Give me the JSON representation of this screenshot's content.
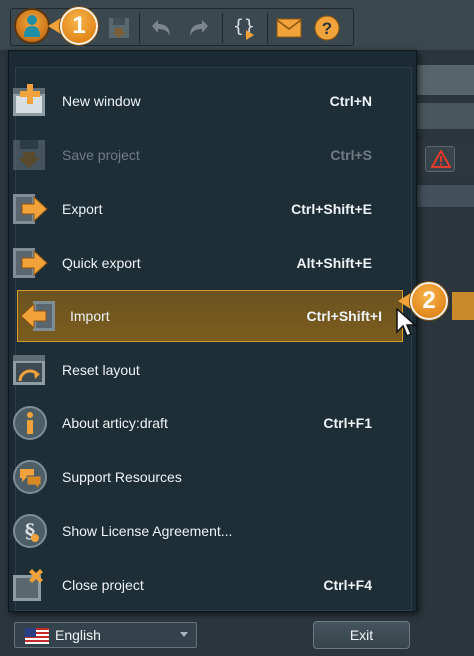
{
  "toolbar": {
    "buttons": [
      {
        "name": "user-icon"
      },
      {
        "name": "save-icon"
      },
      {
        "name": "undo-icon"
      },
      {
        "name": "redo-icon"
      },
      {
        "name": "script-icon"
      },
      {
        "name": "mail-icon"
      },
      {
        "name": "help-icon",
        "glyph": "?"
      }
    ]
  },
  "callouts": {
    "first": "1",
    "second": "2"
  },
  "menu": {
    "items": [
      {
        "label": "New window",
        "shortcut": "Ctrl+N",
        "icon": "new-window-icon",
        "state": "normal"
      },
      {
        "label": "Save project",
        "shortcut": "Ctrl+S",
        "icon": "save-project-icon",
        "state": "disabled"
      },
      {
        "label": "Export",
        "shortcut": "Ctrl+Shift+E",
        "icon": "export-icon",
        "state": "normal"
      },
      {
        "label": "Quick export",
        "shortcut": "Alt+Shift+E",
        "icon": "quick-export-icon",
        "state": "normal"
      },
      {
        "label": "Import",
        "shortcut": "Ctrl+Shift+I",
        "icon": "import-icon",
        "state": "highlighted"
      },
      {
        "label": "Reset layout",
        "shortcut": "",
        "icon": "reset-layout-icon",
        "state": "normal"
      },
      {
        "label": "About articy:draft",
        "shortcut": "Ctrl+F1",
        "icon": "info-icon",
        "state": "normal"
      },
      {
        "label": "Support Resources",
        "shortcut": "",
        "icon": "support-icon",
        "state": "normal"
      },
      {
        "label": "Show License Agreement...",
        "shortcut": "",
        "icon": "license-icon",
        "state": "normal"
      },
      {
        "label": "Close project",
        "shortcut": "Ctrl+F4",
        "icon": "close-project-icon",
        "state": "normal"
      }
    ]
  },
  "footer": {
    "language": "English",
    "exit_label": "Exit"
  },
  "colors": {
    "accent": "#f2a23a",
    "highlight_border": "#d59a2c",
    "menu_bg": "#1e2e37"
  }
}
